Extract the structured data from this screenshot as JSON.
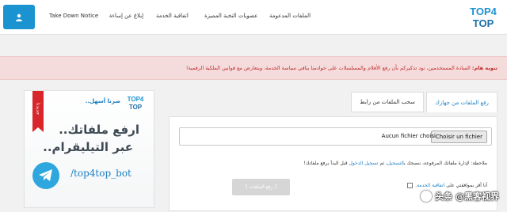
{
  "navbar": {
    "links": [
      {
        "label": "الملفات المدعومة"
      },
      {
        "label": "عضويات النخبة المميزة"
      },
      {
        "label": "اتفاقية الخدمة"
      },
      {
        "label": "إبلاغ عن إساءة"
      },
      {
        "label": "Take Down Notice"
      }
    ],
    "logo_line1": "TOP4",
    "logo_line2": "TOP"
  },
  "alert": {
    "title": "تنويه هام:",
    "message": "السادة المستخدمين، نود تذكيركم بأن رفع الأفلام والمسلسلات على خوادمنا ينافي سياسة الخدمة، ويتعارض مع قوانين الملكية الرقمية!"
  },
  "banner": {
    "ribbon": "جديدنا",
    "small_text": "صرنا أسهل..",
    "line1": "ارفع ملفاتك..",
    "line2": "عبر التيليقرام..",
    "handle": "/top4top_bot"
  },
  "upload": {
    "tabs": [
      {
        "label": "رفع الملفات من جهازك"
      },
      {
        "label": "سحب الملفات من رابط"
      }
    ],
    "file_button": "Choisir un fichier",
    "file_status": "Aucun fichier choisi",
    "note_prefix": "ملاحظة: لإدارة ملفاتك المرفوعة، ننصحك ب",
    "note_link1": "التسجيل",
    "note_mid": "، ثم ",
    "note_link2": "تسجيل الدخول",
    "note_suffix": " قبل البدأ برفع ملفاتك!",
    "agree_prefix": "أنا أقر بموافقتي على ",
    "agree_link": "اتفاقية الخدمة",
    "agree_suffix": ".",
    "submit_label": "[ رفع الملفات ]"
  },
  "watermark": {
    "text": "头条 @黑客视界"
  },
  "colors": {
    "accent": "#1b93d0",
    "alert_bg": "#f5dcdc",
    "alert_text": "#c02b2b"
  }
}
